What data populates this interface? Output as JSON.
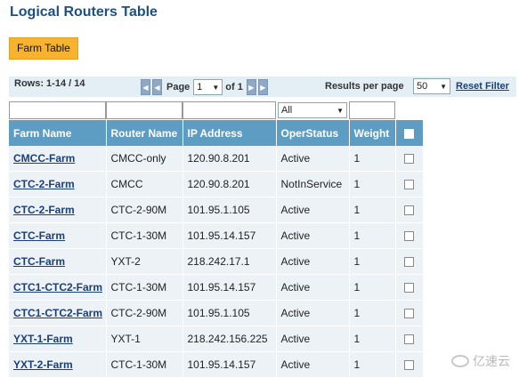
{
  "page": {
    "title": "Logical Routers Table"
  },
  "tabs": {
    "farm_table": "Farm Table"
  },
  "toolbar": {
    "rows_info": "Rows: 1-14 / 14",
    "page_label": "Page",
    "page_value": "1",
    "of_label": "of 1",
    "results_per_page_label": "Results per page",
    "results_per_page_value": "50",
    "reset_filter": "Reset Filter",
    "first_icon": "first-page-icon",
    "prev_icon": "prev-page-icon",
    "next_icon": "next-page-icon",
    "last_icon": "last-page-icon"
  },
  "filters": {
    "oper_status_value": "All"
  },
  "table": {
    "columns": [
      "Farm Name",
      "Router Name",
      "IP Address",
      "OperStatus",
      "Weight"
    ],
    "rows": [
      {
        "farm": "CMCC-Farm",
        "router": "CMCC-only",
        "ip": "120.90.8.201",
        "status": "Active",
        "weight": "1"
      },
      {
        "farm": "CTC-2-Farm",
        "router": "CMCC",
        "ip": "120.90.8.201",
        "status": "NotInService",
        "weight": "1"
      },
      {
        "farm": "CTC-2-Farm",
        "router": "CTC-2-90M",
        "ip": "101.95.1.105",
        "status": "Active",
        "weight": "1"
      },
      {
        "farm": "CTC-Farm",
        "router": "CTC-1-30M",
        "ip": "101.95.14.157",
        "status": "Active",
        "weight": "1"
      },
      {
        "farm": "CTC-Farm",
        "router": "YXT-2",
        "ip": "218.242.17.1",
        "status": "Active",
        "weight": "1"
      },
      {
        "farm": "CTC1-CTC2-Farm",
        "router": "CTC-1-30M",
        "ip": "101.95.14.157",
        "status": "Active",
        "weight": "1"
      },
      {
        "farm": "CTC1-CTC2-Farm",
        "router": "CTC-2-90M",
        "ip": "101.95.1.105",
        "status": "Active",
        "weight": "1"
      },
      {
        "farm": "YXT-1-Farm",
        "router": "YXT-1",
        "ip": "218.242.156.225",
        "status": "Active",
        "weight": "1"
      },
      {
        "farm": "YXT-2-Farm",
        "router": "CTC-1-30M",
        "ip": "101.95.14.157",
        "status": "Active",
        "weight": "1"
      }
    ]
  },
  "watermark": {
    "text": "亿速云"
  },
  "colors": {
    "header_bg": "#5d9dc4",
    "row_bg": "#edf2f7",
    "tab_bg": "#f7b32f",
    "title": "#1f4f7e"
  }
}
